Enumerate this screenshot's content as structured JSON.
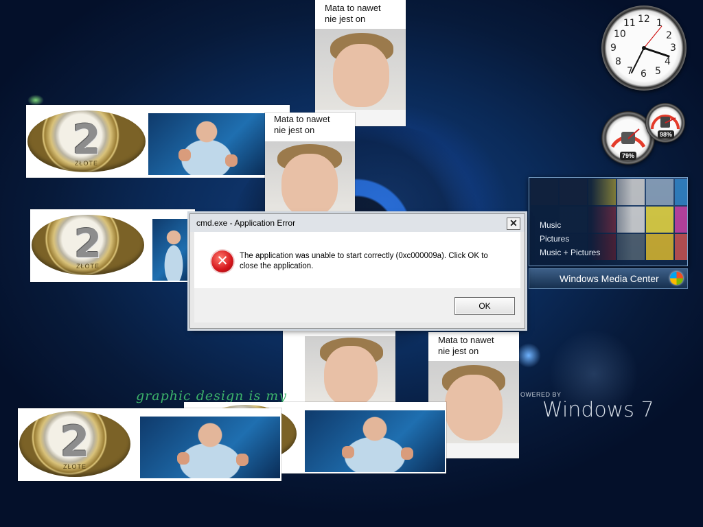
{
  "memes": {
    "caption_line1": "Mata to nawet",
    "caption_line2": "nie jest on",
    "coin_number": "2",
    "coin_label": "ZŁOTE"
  },
  "overlay_text": "graphic design is my",
  "wmc": {
    "items": [
      "Music",
      "Pictures",
      "Music + Pictures"
    ],
    "bar_label": "Windows Media Center"
  },
  "gadgets": {
    "clock_numbers": [
      "12",
      "1",
      "2",
      "3",
      "4",
      "5",
      "6",
      "7",
      "8",
      "9",
      "10",
      "11"
    ],
    "cpu_percent": "79%",
    "memory_percent": "98%"
  },
  "branding": {
    "powered_by": "OWERED BY",
    "windows": "Windows 7"
  },
  "dialog": {
    "title": "cmd.exe - Application Error",
    "message": "The application was unable to start correctly (0xc000009a). Click OK to close the application.",
    "ok_label": "OK",
    "close_glyph": "✕",
    "error_glyph": "✕"
  }
}
